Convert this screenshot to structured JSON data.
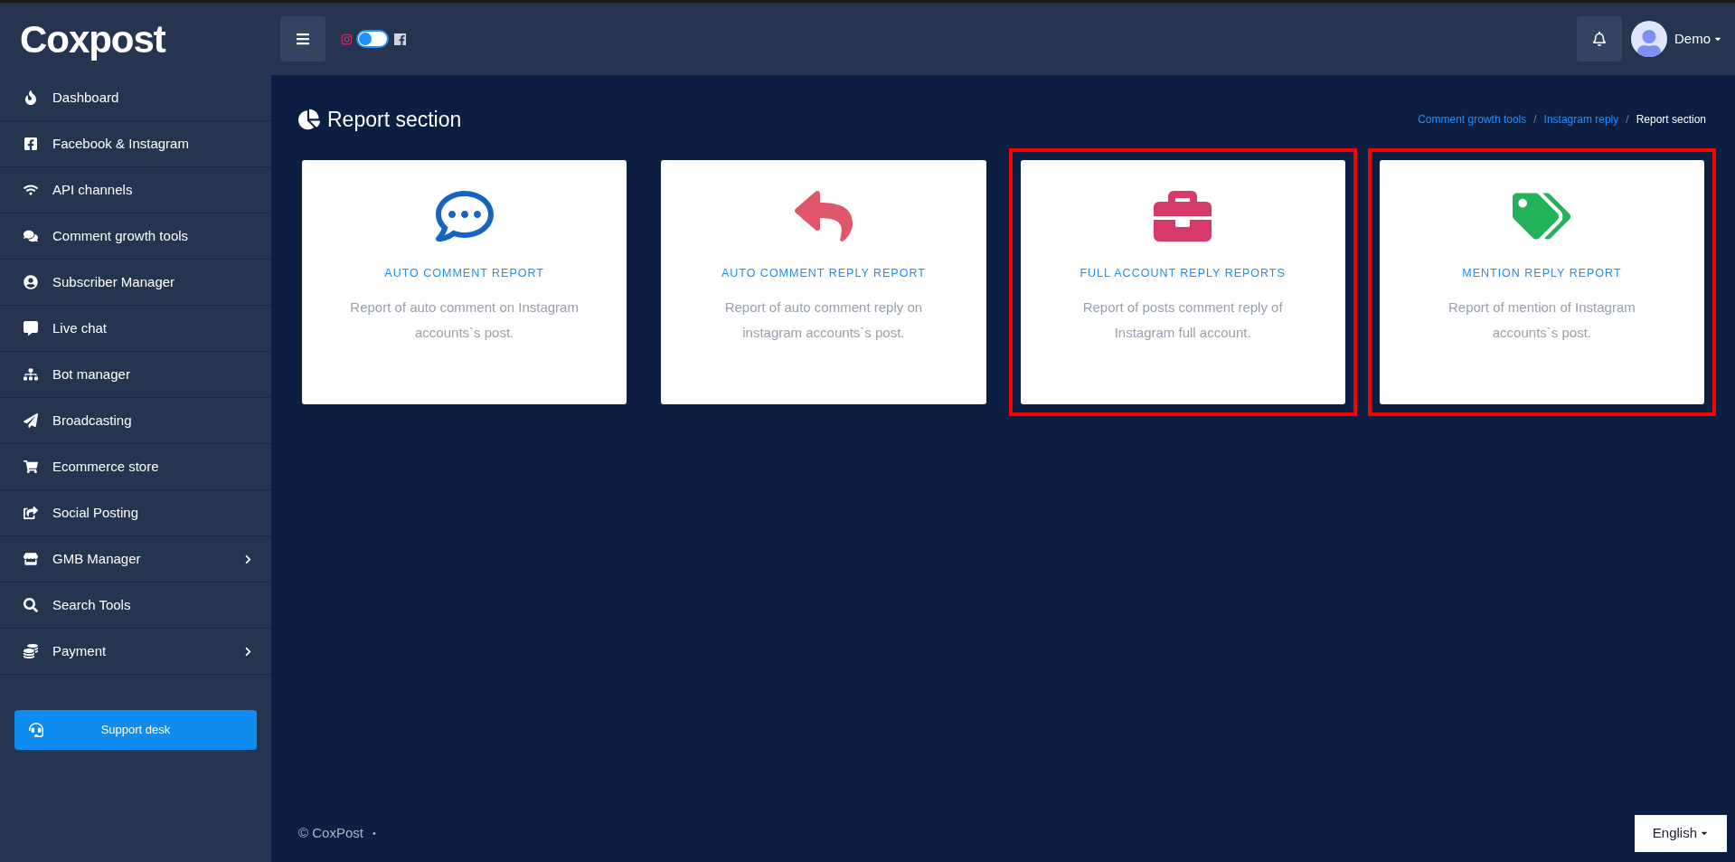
{
  "logo": {
    "text": "Coxpost"
  },
  "header": {
    "channel_toggle": {
      "on": false
    },
    "user": {
      "name": "Demo"
    }
  },
  "sidebar": {
    "items": [
      {
        "label": "Dashboard",
        "has_submenu": false
      },
      {
        "label": "Facebook & Instagram",
        "has_submenu": false
      },
      {
        "label": "API channels",
        "has_submenu": false
      },
      {
        "label": "Comment growth tools",
        "has_submenu": false
      },
      {
        "label": "Subscriber Manager",
        "has_submenu": false
      },
      {
        "label": "Live chat",
        "has_submenu": false
      },
      {
        "label": "Bot manager",
        "has_submenu": false
      },
      {
        "label": "Broadcasting",
        "has_submenu": false
      },
      {
        "label": "Ecommerce store",
        "has_submenu": false
      },
      {
        "label": "Social Posting",
        "has_submenu": false
      },
      {
        "label": "GMB Manager",
        "has_submenu": true
      },
      {
        "label": "Search Tools",
        "has_submenu": false
      },
      {
        "label": "Payment",
        "has_submenu": true
      }
    ],
    "support_button": "Support desk"
  },
  "page": {
    "title": "Report section",
    "breadcrumb": [
      "Comment growth tools",
      "Instagram reply",
      "Report section"
    ],
    "breadcrumb_separator": "/"
  },
  "cards": [
    {
      "title": "AUTO COMMENT REPORT",
      "description": "Report of auto comment on Instagram accounts`s post.",
      "highlighted": false
    },
    {
      "title": "AUTO COMMENT REPLY REPORT",
      "description": "Report of auto comment reply on instagram accounts`s post.",
      "highlighted": false
    },
    {
      "title": "FULL ACCOUNT REPLY REPORTS",
      "description": "Report of posts comment reply of Instagram full account.",
      "highlighted": true
    },
    {
      "title": "MENTION REPLY REPORT",
      "description": "Report of mention of Instagram accounts`s post.",
      "highlighted": true
    }
  ],
  "footer": {
    "copyright": "© CoxPost",
    "separator": "•",
    "language": "English"
  }
}
